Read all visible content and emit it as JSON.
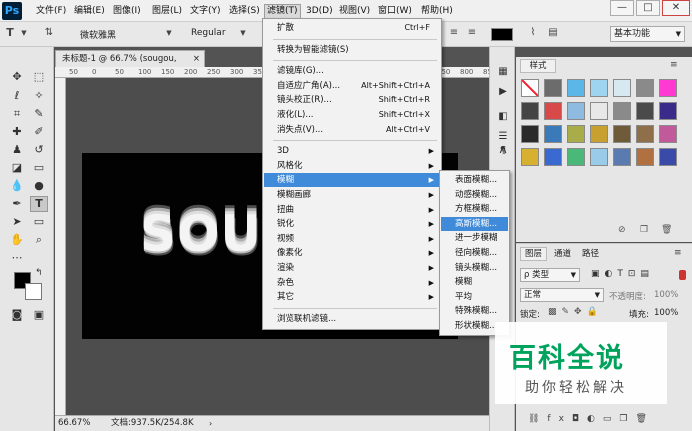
{
  "menubar": {
    "logo": "Ps",
    "items": [
      "文件(F)",
      "编辑(E)",
      "图像(I)",
      "图层(L)",
      "文字(Y)",
      "选择(S)",
      "滤镜(T)",
      "3D(D)",
      "视图(V)",
      "窗口(W)",
      "帮助(H)"
    ],
    "active_item": "滤镜(T)",
    "window_controls": [
      "—",
      "□",
      "✕"
    ]
  },
  "options_bar": {
    "tool_icon": "T",
    "font_family": "微软雅黑",
    "font_style": "Regular",
    "aa_label": "a a",
    "aa_value": "锐利",
    "workspace": "基本功能"
  },
  "document": {
    "tab_title": "未标题-1 @ 66.7% (sougou, RGB/8) *",
    "ruler_ticks": [
      "50",
      "0",
      "50",
      "100",
      "150",
      "200",
      "250",
      "300",
      "350",
      "400",
      "450",
      "500",
      "550",
      "600",
      "650",
      "700",
      "750",
      "800",
      "850"
    ],
    "canvas_text": "SOU"
  },
  "status_bar": {
    "zoom": "66.67%",
    "doc_size": "文档:937.5K/254.8K"
  },
  "filter_menu": {
    "items": [
      {
        "label": "扩散",
        "shortcut": "Ctrl+F"
      },
      {
        "sep": true
      },
      {
        "label": "转换为智能滤镜(S)"
      },
      {
        "sep": true
      },
      {
        "label": "滤镜库(G)..."
      },
      {
        "label": "自适应广角(A)...",
        "shortcut": "Alt+Shift+Ctrl+A"
      },
      {
        "label": "镜头校正(R)...",
        "shortcut": "Shift+Ctrl+R"
      },
      {
        "label": "液化(L)...",
        "shortcut": "Shift+Ctrl+X"
      },
      {
        "label": "消失点(V)...",
        "shortcut": "Alt+Ctrl+V"
      },
      {
        "sep": true
      },
      {
        "label": "3D",
        "arrow": true
      },
      {
        "label": "风格化",
        "arrow": true
      },
      {
        "label": "模糊",
        "arrow": true,
        "highlight": true
      },
      {
        "label": "模糊画廊",
        "arrow": true
      },
      {
        "label": "扭曲",
        "arrow": true
      },
      {
        "label": "锐化",
        "arrow": true
      },
      {
        "label": "视频",
        "arrow": true
      },
      {
        "label": "像素化",
        "arrow": true
      },
      {
        "label": "渲染",
        "arrow": true
      },
      {
        "label": "杂色",
        "arrow": true
      },
      {
        "label": "其它",
        "arrow": true
      },
      {
        "sep": true
      },
      {
        "label": "浏览联机滤镜..."
      }
    ]
  },
  "blur_menu": {
    "items": [
      {
        "label": "表面模糊..."
      },
      {
        "label": "动感模糊..."
      },
      {
        "label": "方框模糊..."
      },
      {
        "label": "高斯模糊...",
        "highlight": true
      },
      {
        "label": "进一步模糊"
      },
      {
        "label": "径向模糊..."
      },
      {
        "label": "镜头模糊..."
      },
      {
        "label": "模糊"
      },
      {
        "label": "平均"
      },
      {
        "label": "特殊模糊..."
      },
      {
        "label": "形状模糊..."
      }
    ]
  },
  "styles_panel": {
    "tab": "样式",
    "swatches": [
      "#ffffff",
      "#6c6c6c",
      "#5ab7e8",
      "#9fd4f0",
      "#d8e8f0",
      "#8a8a8a",
      "#ff3ad2",
      "#444444",
      "#d84a4a",
      "#8fbbe0",
      "#e8e8e8",
      "#8a8a8a",
      "#4a4a4a",
      "#3a2a8a",
      "#2a2a2a",
      "#3a7ab8",
      "#a8ad4a",
      "#c8a030",
      "#6f5a3a",
      "#8f6f4a",
      "#c05a9a",
      "#d8b030",
      "#3a6ad0",
      "#4ab878",
      "#9acbe8",
      "#5a7ab0",
      "#b07040",
      "#3a4aa8"
    ]
  },
  "layers_panel": {
    "tabs": [
      "图层",
      "通道",
      "路径"
    ],
    "kind_label": "ρ 类型",
    "blend_mode": "正常",
    "opacity_label": "不透明度:",
    "opacity_value": "100%",
    "lock_label": "锁定:",
    "fill_label": "填充:",
    "fill_value": "100%"
  },
  "watermark": {
    "main": "百科全说",
    "sub": "助你轻松解决"
  }
}
